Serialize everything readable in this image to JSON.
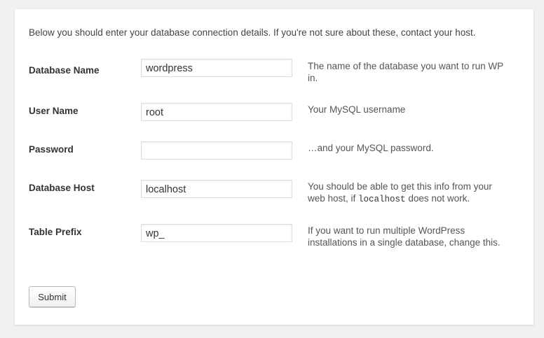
{
  "intro": "Below you should enter your database connection details. If you're not sure about these, contact your host.",
  "fields": [
    {
      "label": "Database Name",
      "value": "wordpress",
      "description": "The name of the database you want to run WP in."
    },
    {
      "label": "User Name",
      "value": "root",
      "description": "Your MySQL username"
    },
    {
      "label": "Password",
      "value": "",
      "description": "…and your MySQL password."
    },
    {
      "label": "Database Host",
      "value": "localhost",
      "description_before": "You should be able to get this info from your web host, if ",
      "description_code": "localhost",
      "description_after": " does not work."
    },
    {
      "label": "Table Prefix",
      "value": "wp_",
      "description": "If you want to run multiple WordPress installations in a single database, change this."
    }
  ],
  "submit_label": "Submit"
}
